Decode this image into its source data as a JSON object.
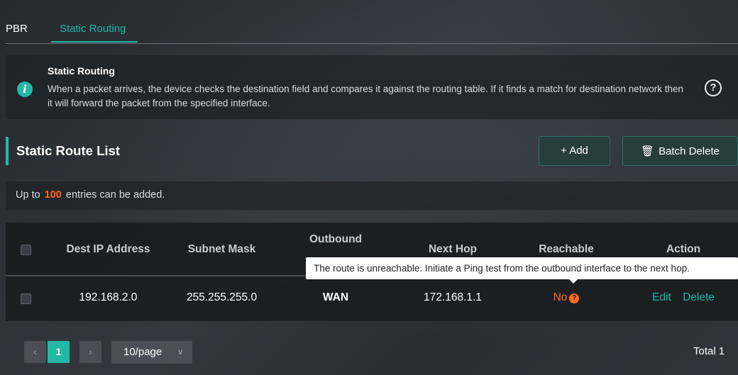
{
  "tabs": [
    {
      "label": "PBR",
      "active": false
    },
    {
      "label": "Static Routing",
      "active": true
    }
  ],
  "info": {
    "title": "Static Routing",
    "text": "When a packet arrives, the device checks the destination field and compares it against the routing table. If it finds a match for destination network then it will forward the packet from the specified interface.",
    "help_icon": "question-circle-icon"
  },
  "list": {
    "title": "Static Route List",
    "add_label": "+ Add",
    "batch_delete_label": "Batch Delete",
    "batch_delete_icon": "trash-icon",
    "limit_prefix": "Up to",
    "limit_number": "100",
    "limit_suffix": "entries can be added."
  },
  "table": {
    "columns": [
      "Dest IP Address",
      "Subnet Mask",
      "Outbound",
      "Next Hop",
      "Reachable",
      "Action"
    ],
    "rows": [
      {
        "dest_ip": "192.168.2.0",
        "subnet_mask": "255.255.255.0",
        "outbound": "WAN",
        "next_hop": "172.168.1.1",
        "reachable": "No",
        "actions": [
          "Edit",
          "Delete"
        ]
      }
    ]
  },
  "tooltip": "The route is unreachable. Initiate a Ping test from the outbound interface to the next hop.",
  "pagination": {
    "current_page": "1",
    "page_size": "10/page",
    "total": "Total 1"
  },
  "colors": {
    "accent": "#23b7a8",
    "warning": "#ff6a1f"
  }
}
